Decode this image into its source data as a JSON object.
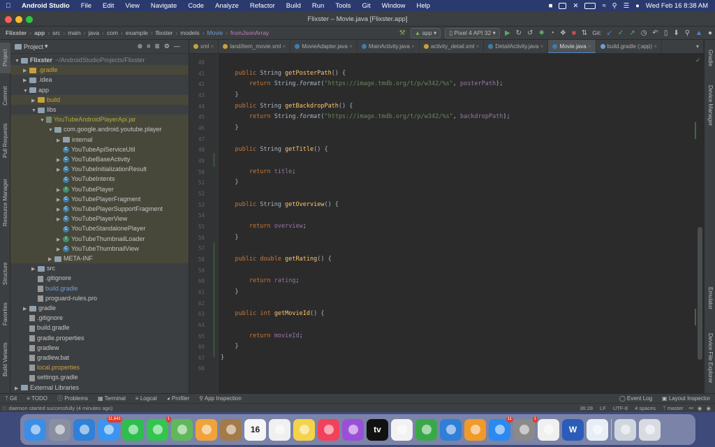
{
  "menubar": {
    "app_name": "Android Studio",
    "items": [
      "File",
      "Edit",
      "View",
      "Navigate",
      "Code",
      "Analyze",
      "Refactor",
      "Build",
      "Run",
      "Tools",
      "Git",
      "Window",
      "Help"
    ],
    "datetime": "Wed Feb 16  8:38 AM"
  },
  "window": {
    "title": "Flixster – Movie.java [Flixster.app]"
  },
  "navbar": {
    "crumbs": [
      "Flixster",
      "app",
      "src",
      "main",
      "java",
      "com",
      "example",
      "flixster",
      "models",
      "Movie",
      "fromJsonArray"
    ],
    "config": "app",
    "device": "Pixel 4 API 32",
    "git_label": "Git:"
  },
  "project_panel": {
    "title": "Project",
    "rows": [
      {
        "label": "Flixster",
        "suffix": "~/AndroidStudioProjects/Flixster",
        "indent": 0,
        "arrow": "down",
        "icon": "fold"
      },
      {
        "label": ".gradle",
        "indent": 1,
        "arrow": "right",
        "icon": "fold-y",
        "color": "#c9a13c"
      },
      {
        "label": ".idea",
        "indent": 1,
        "arrow": "right",
        "icon": "fold"
      },
      {
        "label": "app",
        "indent": 1,
        "arrow": "down",
        "icon": "fold"
      },
      {
        "label": "build",
        "indent": 2,
        "arrow": "right",
        "icon": "fold-y",
        "color": "#c9a13c"
      },
      {
        "label": "libs",
        "indent": 2,
        "arrow": "down",
        "icon": "fold"
      },
      {
        "label": "YouTubeAndroidPlayerApi.jar",
        "indent": 3,
        "arrow": "down",
        "icon": "jar",
        "color": "#a9b04a"
      },
      {
        "label": "com.google.android.youtube.player",
        "indent": 4,
        "arrow": "down",
        "icon": "pkg"
      },
      {
        "label": "internal",
        "indent": 5,
        "arrow": "right",
        "icon": "pkg"
      },
      {
        "label": "YouTubeApiServiceUtil",
        "indent": 5,
        "arrow": "",
        "icon": "cls-c"
      },
      {
        "label": "YouTubeBaseActivity",
        "indent": 5,
        "arrow": "right",
        "icon": "cls-c"
      },
      {
        "label": "YouTubeInitializationResult",
        "indent": 5,
        "arrow": "right",
        "icon": "cls-c"
      },
      {
        "label": "YouTubeIntents",
        "indent": 5,
        "arrow": "",
        "icon": "cls-c"
      },
      {
        "label": "YouTubePlayer",
        "indent": 5,
        "arrow": "right",
        "icon": "cls-i"
      },
      {
        "label": "YouTubePlayerFragment",
        "indent": 5,
        "arrow": "right",
        "icon": "cls-c"
      },
      {
        "label": "YouTubePlayerSupportFragment",
        "indent": 5,
        "arrow": "right",
        "icon": "cls-c"
      },
      {
        "label": "YouTubePlayerView",
        "indent": 5,
        "arrow": "right",
        "icon": "cls-c"
      },
      {
        "label": "YouTubeStandalonePlayer",
        "indent": 5,
        "arrow": "",
        "icon": "cls-c"
      },
      {
        "label": "YouTubeThumbnailLoader",
        "indent": 5,
        "arrow": "right",
        "icon": "cls-i"
      },
      {
        "label": "YouTubeThumbnailView",
        "indent": 5,
        "arrow": "right",
        "icon": "cls-c"
      },
      {
        "label": "META-INF",
        "indent": 4,
        "arrow": "right",
        "icon": "fold"
      },
      {
        "label": "src",
        "indent": 2,
        "arrow": "right",
        "icon": "fold"
      },
      {
        "label": ".gitignore",
        "indent": 2,
        "arrow": "",
        "icon": "file"
      },
      {
        "label": "build.gradle",
        "indent": 2,
        "arrow": "",
        "icon": "file",
        "color": "#6e9ecf"
      },
      {
        "label": "proguard-rules.pro",
        "indent": 2,
        "arrow": "",
        "icon": "file"
      },
      {
        "label": "gradle",
        "indent": 1,
        "arrow": "right",
        "icon": "fold"
      },
      {
        "label": ".gitignore",
        "indent": 1,
        "arrow": "",
        "icon": "file"
      },
      {
        "label": "build.gradle",
        "indent": 1,
        "arrow": "",
        "icon": "file"
      },
      {
        "label": "gradle.properties",
        "indent": 1,
        "arrow": "",
        "icon": "file"
      },
      {
        "label": "gradlew",
        "indent": 1,
        "arrow": "",
        "icon": "file"
      },
      {
        "label": "gradlew.bat",
        "indent": 1,
        "arrow": "",
        "icon": "file"
      },
      {
        "label": "local.properties",
        "indent": 1,
        "arrow": "",
        "icon": "file",
        "color": "#c9a13c"
      },
      {
        "label": "settings.gradle",
        "indent": 1,
        "arrow": "",
        "icon": "file"
      },
      {
        "label": "External Libraries",
        "indent": 0,
        "arrow": "right",
        "icon": "lib"
      }
    ]
  },
  "left_tool_tabs": [
    "Project",
    "Commit",
    "Pull Requests",
    "Resource Manager",
    "Structure",
    "Favorites",
    "Build Variants"
  ],
  "right_tool_tabs": [
    "Gradle",
    "Device Manager",
    "Emulator",
    "Device File Explorer"
  ],
  "tabs": [
    {
      "label": "xml",
      "color": "#c9a13c"
    },
    {
      "label": "land/item_movie.xml",
      "color": "#c9a13c"
    },
    {
      "label": "MovieAdapter.java",
      "color": "#3e7ea8"
    },
    {
      "label": "MainActivity.java",
      "color": "#3e7ea8"
    },
    {
      "label": "activity_detail.xml",
      "color": "#c9a13c"
    },
    {
      "label": "DetailActivity.java",
      "color": "#3e7ea8"
    },
    {
      "label": "Movie.java",
      "color": "#3e7ea8",
      "active": true
    },
    {
      "label": "build.gradle (:app)",
      "color": "#6e9ecf"
    }
  ],
  "editor": {
    "lines": [
      {
        "n": "40",
        "t": ""
      },
      {
        "n": "41",
        "t": "    public String getPosterPath() {"
      },
      {
        "n": "42",
        "t": "        return String.format(\"https://image.tmdb.org/t/p/w342/%s\", posterPath);"
      },
      {
        "n": "43",
        "t": "    }"
      },
      {
        "n": "44",
        "t": "    public String getBackdropPath() {"
      },
      {
        "n": "45",
        "t": "        return String.format(\"https://image.tmdb.org/t/p/w342/%s\", backdropPath);"
      },
      {
        "n": "46",
        "t": "    }"
      },
      {
        "n": "47",
        "t": ""
      },
      {
        "n": "48",
        "t": "    public String getTitle() {"
      },
      {
        "n": "49",
        "t": ""
      },
      {
        "n": "50",
        "t": "        return title;"
      },
      {
        "n": "51",
        "t": "    }"
      },
      {
        "n": "52",
        "t": ""
      },
      {
        "n": "53",
        "t": "    public String getOverview() {"
      },
      {
        "n": "54",
        "t": ""
      },
      {
        "n": "55",
        "t": "        return overview;"
      },
      {
        "n": "56",
        "t": "    }"
      },
      {
        "n": "57",
        "t": ""
      },
      {
        "n": "58",
        "t": "    public double getRating() {"
      },
      {
        "n": "59",
        "t": ""
      },
      {
        "n": "60",
        "t": "        return rating;"
      },
      {
        "n": "61",
        "t": "    }"
      },
      {
        "n": "62",
        "t": ""
      },
      {
        "n": "63",
        "t": "    public int getMovieId() {"
      },
      {
        "n": "64",
        "t": ""
      },
      {
        "n": "65",
        "t": "        return movieId;"
      },
      {
        "n": "66",
        "t": "    }"
      },
      {
        "n": "67",
        "t": "}"
      },
      {
        "n": "68",
        "t": ""
      }
    ]
  },
  "bottom_tools": [
    "Git",
    "TODO",
    "Problems",
    "Terminal",
    "Logcat",
    "Profiler",
    "App Inspection"
  ],
  "bottom_tools_right": [
    "Event Log",
    "Layout Inspector"
  ],
  "status": {
    "message": "daemon started successfully (4 minutes ago)",
    "position": "36:28",
    "line_sep": "LF",
    "encoding": "UTF-8",
    "indent": "4 spaces",
    "branch": "master"
  },
  "dock": {
    "apps": [
      {
        "name": "finder",
        "color": "#3a8ee6"
      },
      {
        "name": "launchpad",
        "color": "#8a8fa0"
      },
      {
        "name": "safari",
        "color": "#2f80d8"
      },
      {
        "name": "mail",
        "color": "#3b95f0",
        "badge": "11,641"
      },
      {
        "name": "facetime",
        "color": "#2cbf4d"
      },
      {
        "name": "messages",
        "color": "#33c54f",
        "badge": "1"
      },
      {
        "name": "maps",
        "color": "#5fb85a"
      },
      {
        "name": "photos",
        "color": "#f0a33a"
      },
      {
        "name": "contacts",
        "color": "#a37a4a"
      },
      {
        "name": "calendar",
        "color": "#f5f5f5",
        "text": "16"
      },
      {
        "name": "reminders",
        "color": "#f0f0f0"
      },
      {
        "name": "notes",
        "color": "#f4d34a"
      },
      {
        "name": "music",
        "color": "#f0425a"
      },
      {
        "name": "podcasts",
        "color": "#9b4fd6"
      },
      {
        "name": "tv",
        "color": "#111111",
        "text": "tv"
      },
      {
        "name": "news",
        "color": "#f2f2f2"
      },
      {
        "name": "numbers",
        "color": "#3aa84a"
      },
      {
        "name": "keynote",
        "color": "#2f7fd6"
      },
      {
        "name": "pages",
        "color": "#f09a2a"
      },
      {
        "name": "app-store",
        "color": "#2a8af0",
        "badge": "11"
      },
      {
        "name": "system-preferences",
        "color": "#8a8a8a",
        "badge": "1"
      },
      {
        "name": "chrome",
        "color": "#f0f0f0"
      },
      {
        "name": "word",
        "color": "#2b5cb8",
        "text": "W"
      },
      {
        "name": "android-studio",
        "color": "#e8eef5"
      },
      {
        "name": "preview",
        "color": "#cfd6de"
      },
      {
        "name": "trash",
        "color": "#d8dce2"
      }
    ]
  }
}
